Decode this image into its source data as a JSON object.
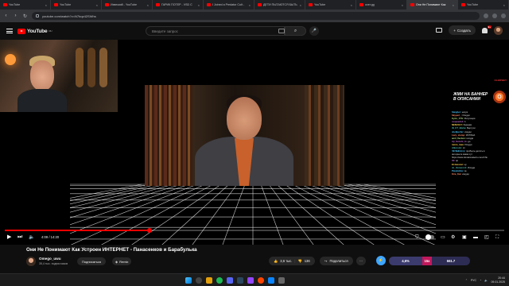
{
  "browser": {
    "tabs": [
      {
        "label": "YouTube",
        "active": false
      },
      {
        "label": "YouTube",
        "active": false
      },
      {
        "label": "Ихвеский - YouTube",
        "active": false
      },
      {
        "label": "ГАРИК ПОТЕР - VSD C",
        "active": false
      },
      {
        "label": "I Joined a Predator Cult -",
        "active": false
      },
      {
        "label": "ДЕТИ ПЫТАЮТСЯ БЫТЬ",
        "active": false
      },
      {
        "label": "YouTube",
        "active": false
      },
      {
        "label": "over.gg",
        "active": false
      },
      {
        "label": "Они Не Понимают Как",
        "active": true
      },
      {
        "label": "YouTube",
        "active": false
      }
    ],
    "url": "youtube.com/watch?v=N7bqz42SWhs"
  },
  "header": {
    "logo_text": "YouTube",
    "logo_region": "RU",
    "search_placeholder": "Введите запрос",
    "create_label": "Создать",
    "notif_count": "9+"
  },
  "chat": {
    "header": "OLIMPBET",
    "banner": "ЖМИ НА БАННЕР В ОПИСАНИИ",
    "coin_label": "O",
    "messages": [
      {
        "user": "Sleigher:",
        "text": "нихуя"
      },
      {
        "user": "Skypert_:",
        "text": "Ихкуди"
      },
      {
        "user": "Kyiru_FTS:",
        "text": "Репутация"
      },
      {
        "user": "ssspeedo1:",
        "text": "1"
      },
      {
        "user": "NENUXLY:",
        "text": "баранки"
      },
      {
        "user": "iN_KT_Blaha:",
        "text": "Вертухи"
      },
      {
        "user": "shellperfer:",
        "text": "ихкуди"
      },
      {
        "user": "Lazy_slump:",
        "text": "ИСТИНА"
      },
      {
        "user": "amil_flecken:",
        "text": "ихкуди"
      },
      {
        "user": "Aji_Sunshi_lo:",
        "text": "до"
      },
      {
        "user": "mmm_maa:",
        "text": "Ихкуди"
      },
      {
        "user": "Alkuroim:",
        "text": "сп"
      },
      {
        "user": "ЧЕЧБЕНоту:",
        "text": "прибыль делить в"
      },
      {
        "user": "",
        "text": "интернете мама чут"
      },
      {
        "user": "",
        "text": "https://www.donationalerts.com/r/ihk"
      },
      {
        "user": "ihl:",
        "text": "ор"
      },
      {
        "user": "EI-Gerezar:",
        "text": "ну"
      },
      {
        "user": "Jo_Vemuron1:",
        "text": "Ихкуди"
      },
      {
        "user": "Pavelatina:",
        "text": "ха"
      },
      {
        "user": "Kira_Kai:",
        "text": "ихкуди"
      }
    ]
  },
  "player": {
    "time": "4:09 / 14:20",
    "progress": 0.29
  },
  "video": {
    "title": "Они Не Понимают Как Устроен ИНТЕРНЕТ - Панасенков и Барабулька",
    "channel": "Omego_uwu",
    "subscribers": "35,4 тыс. подписчиков",
    "subscribe_label": "Подписаться",
    "remix_label": "Remix",
    "likes": "3,6 тыс.",
    "dislikes": "136",
    "share_label": "Поделиться",
    "ratings": [
      {
        "value": "4,6%",
        "color": "#3b3b6e"
      },
      {
        "value": "15x",
        "color": "#c2185b"
      },
      {
        "value": "661.7",
        "color": "#2c2c54"
      }
    ]
  },
  "taskbar": {
    "lang": "РУС",
    "time": "20:44",
    "date": "09.01.2025"
  },
  "colors": {
    "accent": "#ff0000",
    "grid": "#ffffff"
  }
}
